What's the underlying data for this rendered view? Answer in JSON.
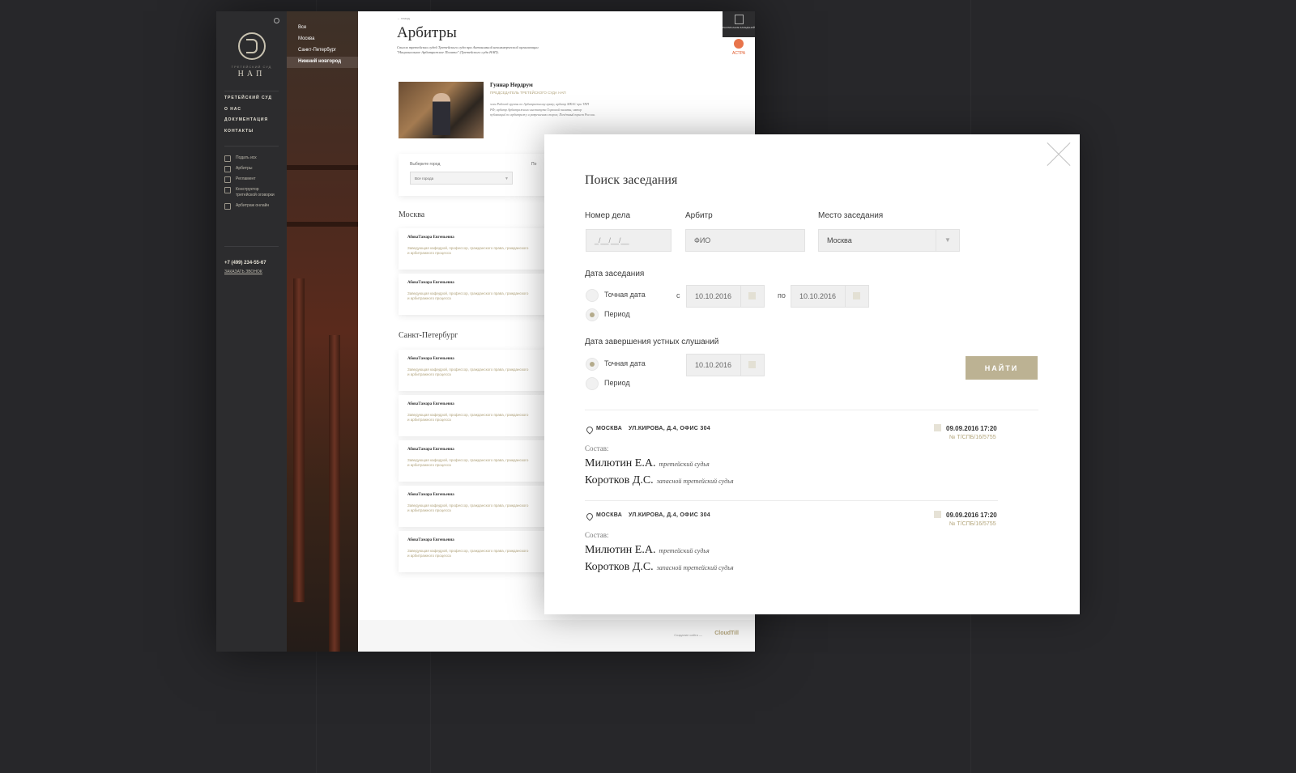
{
  "site": {
    "logo_sub": "ТРЕТЕЙСКИЙ СУД",
    "logo_main": "НАП",
    "city_filter": [
      "Все",
      "Москва",
      "Санкт-Петербург",
      "Нижний новгород"
    ],
    "nav": [
      "ТРЕТЕЙСКИЙ СУД",
      "О НАС",
      "ДОКУМЕНТАЦИЯ",
      "КОНТАКТЫ"
    ],
    "tools": [
      {
        "icon": "pen-icon",
        "label": "Подать иск"
      },
      {
        "icon": "people-icon",
        "label": "Арбитры"
      },
      {
        "icon": "scales-icon",
        "label": "Регламент"
      },
      {
        "icon": "sliders-icon",
        "label": "Конструктор третейской оговорки"
      },
      {
        "icon": "globe-icon",
        "label": "Арбитраж онлайн"
      }
    ],
    "phone": "+7 (499) 234-55-67",
    "callback": "ЗАКАЗАТЬ ЗВОНОК",
    "breadcrumb": "← назад",
    "page_title": "Арбитры",
    "page_desc": "Список третейских судей Третейского суда при Автономной некоммерческой организации \"Национальное Арбитражное Палата\" (Третейского суда НАП).",
    "chief_name": "Гуннар Нердрум",
    "chief_role": "ПРЕДСЕДАТЕЛЬ ТРЕТЕЙСКОГО СУДА НАП",
    "chief_bio": "член Рабочей группы по Арбитражному праву; арбитр МКАС при ТПП РФ; арбитр Арбитражного института Торговой палаты; автор публикаций по арбитражу и разрешению споров; Почётный юрист России.",
    "filter_label": "Выберите город",
    "filter_value": "Все города",
    "filter_other": "По",
    "city1": "Москва",
    "city2": "Санкт-Петербург",
    "arb_name": "АбоваТамара Евгеньевна",
    "arb_desc": "Заведующая кафедрой, профессор, гражданского права, гражданского и арбитражного процесса",
    "schedule": "РАСПИСАНИЕ ЗАСЕДАНИЙ",
    "astra": "АСТРА",
    "footer_label": "Создание сайта —",
    "footer_brand": "CloudTill"
  },
  "modal": {
    "title": "Поиск заседания",
    "case_label": "Номер дела",
    "case_placeholder": "_/__/__/__",
    "arbiter_label": "Арбитр",
    "arbiter_placeholder": "ФИО",
    "place_label": "Место заседания",
    "place_value": "Москва",
    "date_label": "Дата заседания",
    "exact_date": "Точная дата",
    "period": "Период",
    "from": "с",
    "to": "по",
    "date_from": "10.10.2016",
    "date_to": "10.10.2016",
    "hearing_label": "Дата завершения устных слушаний",
    "hearing_date": "10.10.2016",
    "find": "НАЙТИ",
    "results": [
      {
        "city": "МОСКВА",
        "address": "УЛ.КИРОВА, Д.4, ОФИС 304",
        "datetime": "09.09.2016  17:20",
        "number": "№ Т/СПБ/16/5755",
        "sostav": "Состав:",
        "members": [
          {
            "name": "Милютин Е.А.",
            "role": "третейский судья"
          },
          {
            "name": "Коротков Д.С.",
            "role": "запасной третейский судья"
          }
        ]
      },
      {
        "city": "МОСКВА",
        "address": "УЛ.КИРОВА, Д.4, ОФИС 304",
        "datetime": "09.09.2016  17:20",
        "number": "№ Т/СПБ/16/5755",
        "sostav": "Состав:",
        "members": [
          {
            "name": "Милютин Е.А.",
            "role": "третейский судья"
          },
          {
            "name": "Коротков Д.С.",
            "role": "запасной третейский судья"
          }
        ]
      }
    ]
  }
}
